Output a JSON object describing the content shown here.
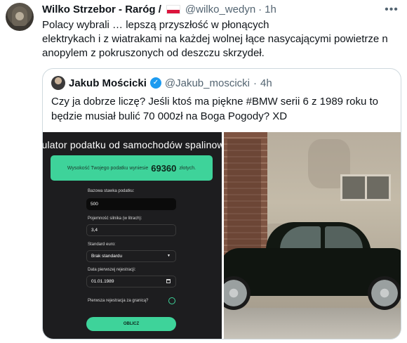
{
  "tweet": {
    "author_name": "Wilko Strzebor - Raróg /",
    "author_handle": "@wilko_wedyn",
    "separator": "·",
    "time": "1h",
    "more_icon": "more-dots-icon",
    "text_lines": [
      "Polacy wybrali … lepszą przyszłość w płonących",
      "elektrykach i z wiatrakami na każdej wolnej łące nasycającymi powietrze n",
      "anopylem z pokruszonych od deszczu skrzydeł."
    ]
  },
  "quote": {
    "author_name": "Jakub Mościcki",
    "author_handle": "@Jakub_moscicki",
    "separator": "·",
    "time": "4h",
    "verified_color": "#1d9bf0",
    "text_lines": [
      "Czy ja dobrze liczę? Jeśli ktoś ma piękne #BMW serii 6 z 1989 roku to",
      "będzie musiał bulić 70 000zł na Boga Pogody? XD"
    ]
  },
  "calculator": {
    "title": "lkulator podatku od samochodów spalinowy",
    "result_prefix": "Wysokość Twojego podatku wyniesie",
    "result_amount": "69360",
    "result_suffix": "złotych.",
    "fields": {
      "base_label": "Bazowa stawka podatku:",
      "base_value": "500",
      "engine_label": "Pojemność silnika (w litrach):",
      "engine_value": "3,4",
      "euro_label": "Standard euro:",
      "euro_value": "Brak standardu",
      "date_label": "Data pierwszej rejestracji:",
      "date_value": "01.01.1989",
      "abroad_label": "Pierwsza rejestracja za granicą?"
    },
    "button_label": "OBLICZ",
    "accent_color": "#3ed39a"
  }
}
